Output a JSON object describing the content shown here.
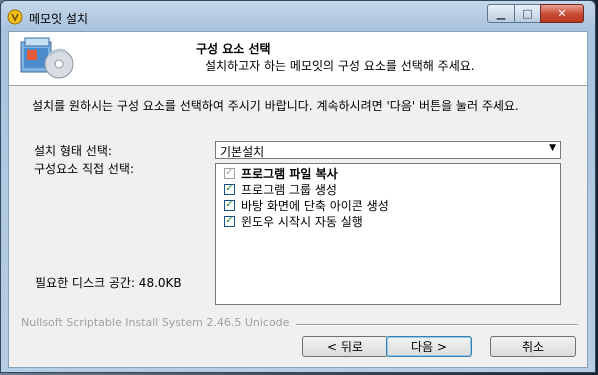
{
  "window": {
    "title": "메모잇 설치"
  },
  "header": {
    "title": "구성 요소 선택",
    "subtitle": "설치하고자 하는 메모잇의 구성 요소를 선택해 주세요."
  },
  "description": "설치를 원하시는 구성 요소를 선택하여 주시기 바랍니다. 계속하시려면 '다음' 버튼을 눌러 주세요.",
  "labels": {
    "install_type": "설치 형태 선택:",
    "components": "구성요소 직접 선택:",
    "space_required": "필요한 디스크 공간: 48.0KB"
  },
  "install_type_select": {
    "value": "기본설치"
  },
  "components": [
    {
      "label": "프로그램 파일 복사",
      "checked": true,
      "disabled": true,
      "bold": true
    },
    {
      "label": "프로그램 그룹 생성",
      "checked": true,
      "disabled": false,
      "bold": false
    },
    {
      "label": "바탕 화면에 단축 아이콘 생성",
      "checked": true,
      "disabled": false,
      "bold": false
    },
    {
      "label": "윈도우 시작시 자동 실행",
      "checked": true,
      "disabled": false,
      "bold": false
    }
  ],
  "footer": {
    "branding": "Nullsoft Scriptable Install System 2.46.5 Unicode"
  },
  "buttons": {
    "back": "< 뒤로",
    "next": "다음 >",
    "cancel": "취소"
  }
}
